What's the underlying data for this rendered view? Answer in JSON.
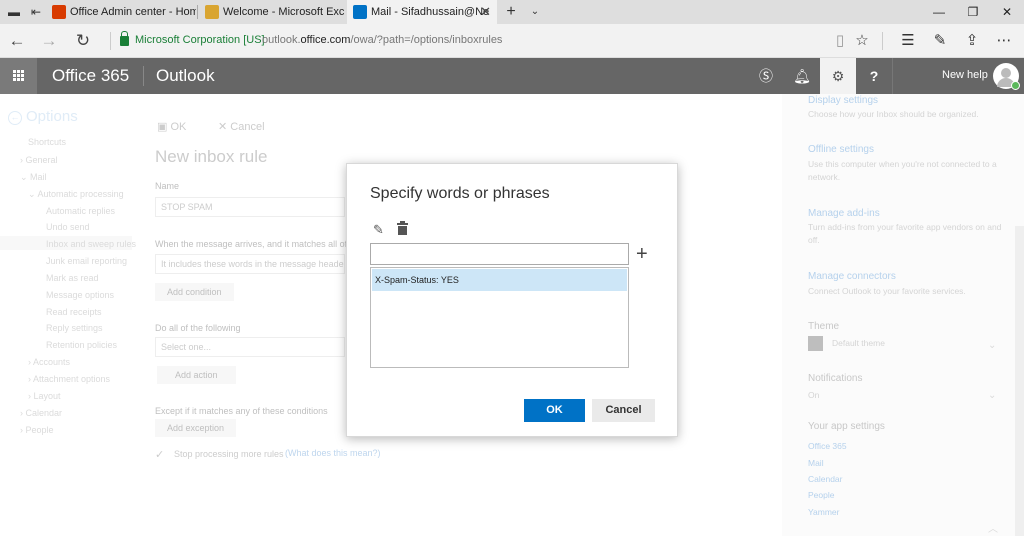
{
  "browser": {
    "tabs": [
      {
        "label": "Office Admin center - Home",
        "icon": "office-icon",
        "color": "#d83b01"
      },
      {
        "label": "Welcome - Microsoft Exchange",
        "icon": "exchange-icon",
        "color": "#d9a531"
      },
      {
        "label": "Mail - Sifadhussain@Ne",
        "icon": "outlook-icon",
        "color": "#0072c6",
        "active": true
      }
    ],
    "site_identity": "Microsoft Corporation [US]",
    "url_prefix": "outlook.",
    "url_domain": "office.com",
    "url_path": "/owa/?path=/options/inboxrules"
  },
  "o365": {
    "brand": "Office 365",
    "app": "Outlook",
    "user": "New help"
  },
  "left_nav": {
    "title": "Options",
    "items": [
      "Shortcuts",
      "› General",
      "⌄ Mail",
      "⌄ Automatic processing",
      "Automatic replies",
      "Undo send",
      "Inbox and sweep rules",
      "Junk email reporting",
      "Mark as read",
      "Message options",
      "Read receipts",
      "Reply settings",
      "Retention policies",
      "› Accounts",
      "› Attachment options",
      "› Layout",
      "› Calendar",
      "› People"
    ]
  },
  "editor": {
    "ok": "OK",
    "cancel": "Cancel",
    "title": "New inbox rule",
    "name_label": "Name",
    "name_value": "STOP SPAM",
    "condition_label": "When the message arrives, and it matches all of",
    "condition_value": "It includes these words in the message header...",
    "add_condition": "Add condition",
    "actions_label": "Do all of the following",
    "actions_placeholder": "Select one...",
    "add_action": "Add action",
    "except_label": "Except if it matches any of these conditions",
    "add_exception": "Add exception",
    "stop_label": "Stop processing more rules",
    "stop_help": "(What does this mean?)"
  },
  "settings_panel": {
    "display_link": "Display settings",
    "display_desc": "Choose how your Inbox should be organized.",
    "offline_link": "Offline settings",
    "offline_desc": "Use this computer when you're not connected to a network.",
    "addins_link": "Manage add-ins",
    "addins_desc": "Turn add-ins from your favorite app vendors on and off.",
    "connectors_link": "Manage connectors",
    "connectors_desc": "Connect Outlook to your favorite services.",
    "theme_head": "Theme",
    "theme_value": "Default theme",
    "notif_head": "Notifications",
    "notif_value": "On",
    "app_settings_head": "Your app settings",
    "apps": [
      "Office 365",
      "Mail",
      "Calendar",
      "People",
      "Yammer"
    ]
  },
  "dialog": {
    "title": "Specify words or phrases",
    "input_value": "",
    "items": [
      "X-Spam-Status: YES"
    ],
    "ok": "OK",
    "cancel": "Cancel",
    "accent": "#0072c6"
  }
}
